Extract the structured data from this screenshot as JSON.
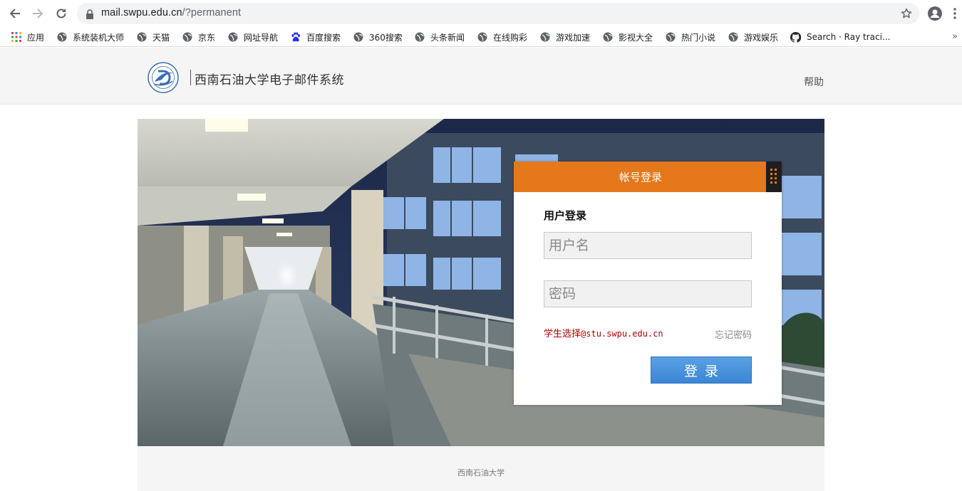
{
  "browser": {
    "url_host": "mail.swpu.edu.cn",
    "url_path": "/?permanent",
    "bookmarks": [
      {
        "label": "应用",
        "icon": "apps-grid-icon"
      },
      {
        "label": "系统装机大师",
        "icon": "globe-icon"
      },
      {
        "label": "天猫",
        "icon": "globe-icon"
      },
      {
        "label": "京东",
        "icon": "globe-icon"
      },
      {
        "label": "网址导航",
        "icon": "globe-icon"
      },
      {
        "label": "百度搜索",
        "icon": "baidu-paw-icon"
      },
      {
        "label": "360搜索",
        "icon": "globe-icon"
      },
      {
        "label": "头条新闻",
        "icon": "globe-icon"
      },
      {
        "label": "在线购彩",
        "icon": "globe-icon"
      },
      {
        "label": "游戏加速",
        "icon": "globe-icon"
      },
      {
        "label": "影视大全",
        "icon": "globe-icon"
      },
      {
        "label": "热门小说",
        "icon": "globe-icon"
      },
      {
        "label": "游戏娱乐",
        "icon": "globe-icon"
      },
      {
        "label": "Search · Ray traci...",
        "icon": "github-icon"
      }
    ],
    "more_label": "»"
  },
  "header": {
    "site_title": "西南石油大学电子邮件系统",
    "help_label": "帮助"
  },
  "login": {
    "panel_title": "帐号登录",
    "form_title": "用户登录",
    "username_placeholder": "用户名",
    "password_placeholder": "密码",
    "student_tip_prefix": "学生选择",
    "student_tip_domain": "@stu.swpu.edu.cn",
    "forgot_label": "忘记密码",
    "submit_label": "登录"
  },
  "footer": {
    "text": "西南石油大学"
  },
  "colors": {
    "panel_header": "#e4781a",
    "login_button": "#3a86d6",
    "student_tip": "#b00000"
  }
}
